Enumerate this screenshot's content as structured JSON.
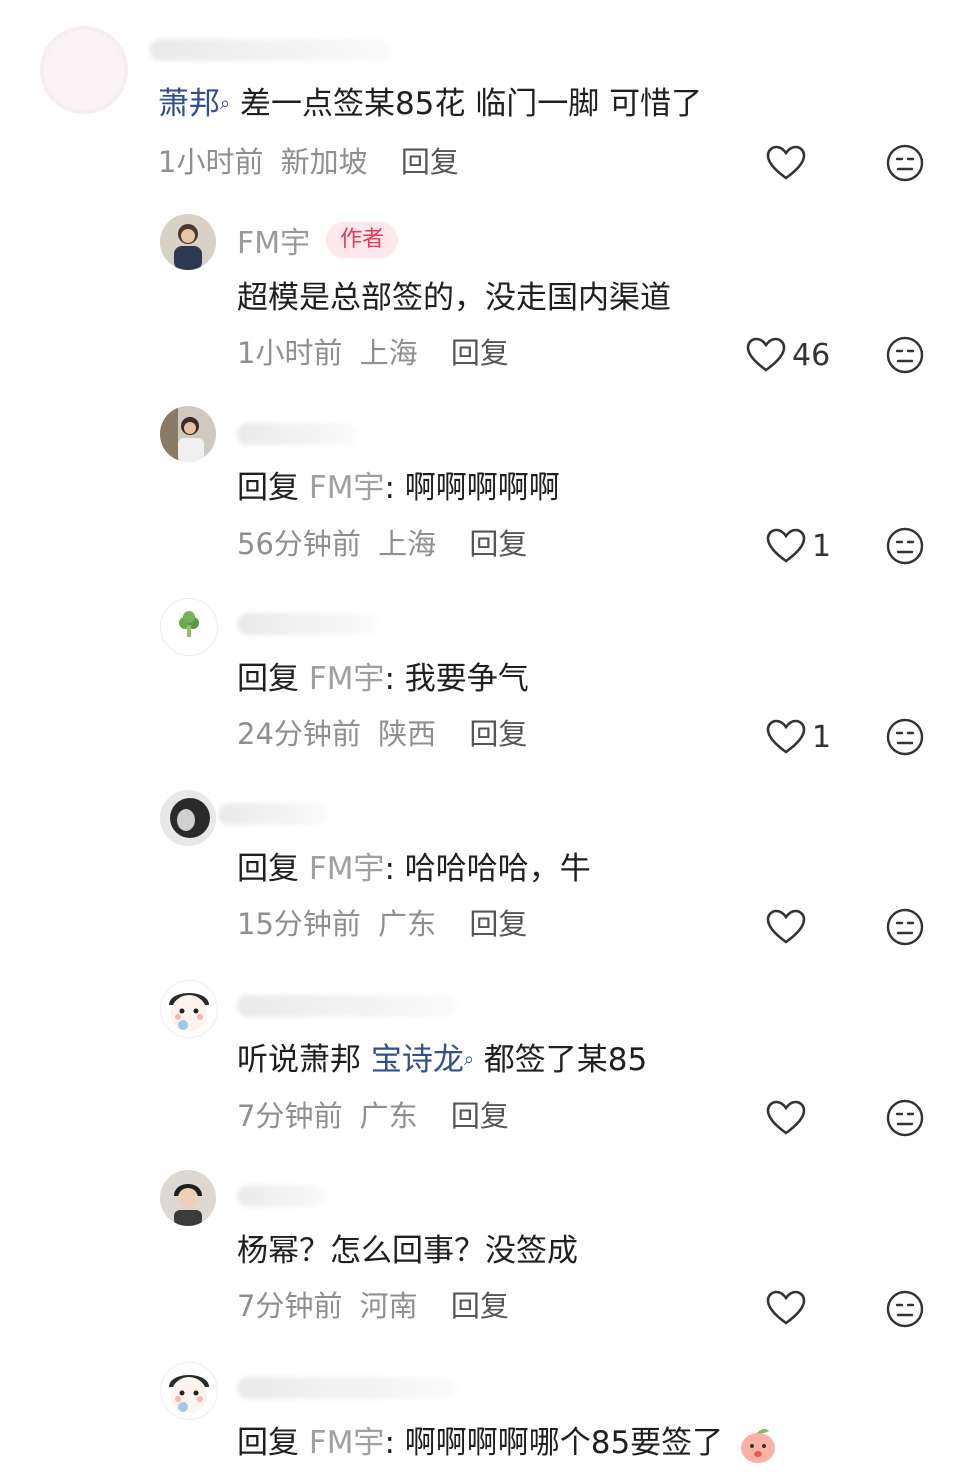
{
  "comments": [
    {
      "avatar_icon": "pink-blank-avatar",
      "content_mention": "萧邦",
      "content_search_tag": "⌕",
      "content_text": " 差一点签某85花 临门一脚 可惜了",
      "time": "1小时前",
      "location": "新加坡",
      "reply_label": "回复",
      "like_count": ""
    },
    {
      "avatar_icon": "man-portrait-avatar",
      "username": "FM宇",
      "badge": "作者",
      "content_text": "超模是总部签的，没走国内渠道",
      "time": "1小时前",
      "location": "上海",
      "reply_label": "回复",
      "like_count": "46"
    },
    {
      "avatar_icon": "man-street-avatar",
      "reply_prefix": "回复 ",
      "reply_target": "FM宇",
      "content_text": ": 啊啊啊啊啊",
      "time": "56分钟前",
      "location": "上海",
      "reply_label": "回复",
      "like_count": "1"
    },
    {
      "avatar_icon": "broccoli-avatar",
      "reply_prefix": "回复 ",
      "reply_target": "FM宇",
      "content_text": ": 我要争气",
      "time": "24分钟前",
      "location": "陕西",
      "reply_label": "回复",
      "like_count": "1"
    },
    {
      "avatar_icon": "woman-bw-avatar",
      "reply_prefix": "回复 ",
      "reply_target": "FM宇",
      "content_text": ": 哈哈哈哈，牛",
      "time": "15分钟前",
      "location": "广东",
      "reply_label": "回复",
      "like_count": ""
    },
    {
      "avatar_icon": "cartoon-baby-avatar",
      "content_text": "听说萧邦 ",
      "content_mention": "宝诗龙",
      "content_search_tag": "⌕",
      "content_text_after": " 都签了某85",
      "time": "7分钟前",
      "location": "广东",
      "reply_label": "回复",
      "like_count": ""
    },
    {
      "avatar_icon": "young-man-avatar",
      "content_text": "杨幂？怎么回事？没签成",
      "time": "7分钟前",
      "location": "河南",
      "reply_label": "回复",
      "like_count": ""
    },
    {
      "avatar_icon": "cartoon-baby-avatar",
      "reply_prefix": "回复 ",
      "reply_target": "FM宇",
      "content_text": ": 啊啊啊啊哪个85要签了",
      "emoji_icon": "peach-emoji",
      "time": "",
      "location": "",
      "reply_label": "",
      "like_count": ""
    }
  ],
  "icons": {
    "like": "heart-outline-icon",
    "dislike": "meh-face-icon"
  },
  "colors": {
    "mention": "#2f4f8f",
    "badge_text": "#e8385a",
    "badge_bg": "#fde8ec",
    "meta": "#8f8f8f"
  }
}
